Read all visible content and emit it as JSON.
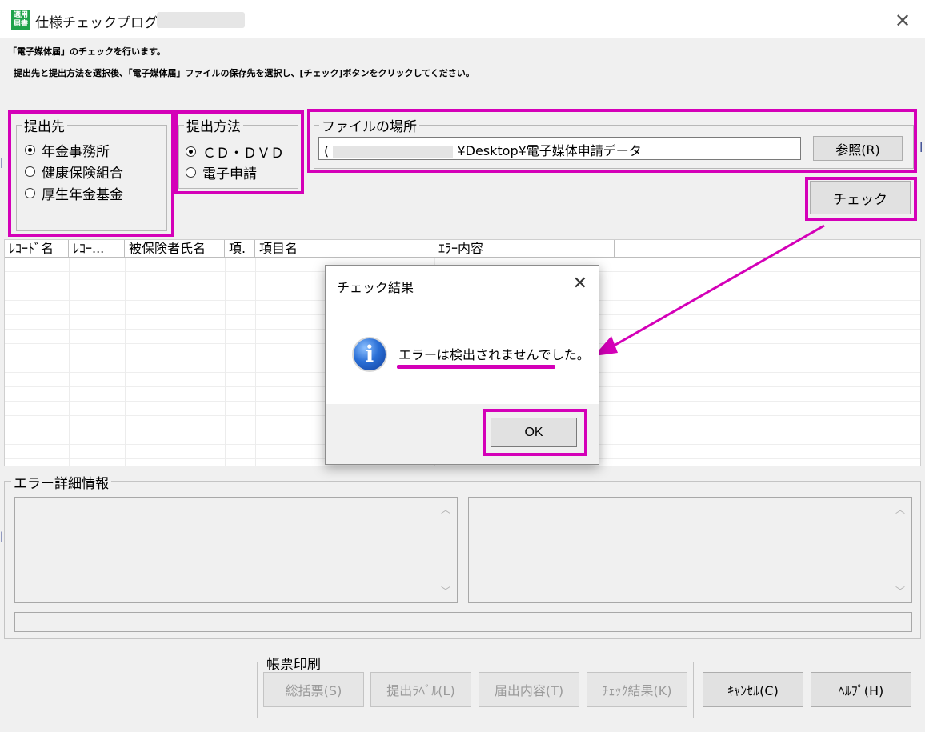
{
  "window": {
    "title": "仕様チェックプログラム",
    "app_icon_text": "適用届書",
    "close_glyph": "✕"
  },
  "instructions": {
    "line1": "「電子媒体届」のチェックを行います。",
    "line2": "提出先と提出方法を選択後、「電子媒体届」ファイルの保存先を選択し、[チェック]ボタンをクリックしてください。"
  },
  "destination": {
    "legend": "提出先",
    "options": [
      {
        "label": "年金事務所",
        "checked": true
      },
      {
        "label": "健康保険組合",
        "checked": false
      },
      {
        "label": "厚生年金基金",
        "checked": false
      }
    ]
  },
  "method": {
    "legend": "提出方法",
    "options": [
      {
        "label": "ＣＤ・ＤＶＤ",
        "checked": true
      },
      {
        "label": "電子申請",
        "checked": false
      }
    ]
  },
  "file": {
    "legend": "ファイルの場所",
    "path_prefix": "(",
    "path_value": "¥Desktop¥電子媒体申請データ",
    "browse_label": "参照(R)"
  },
  "check_button": "チェック",
  "grid": {
    "columns": [
      "ﾚｺｰﾄﾞ名",
      "ﾚｺｰ...",
      "被保険者氏名",
      "項.",
      "項目名",
      "ｴﾗｰ内容"
    ]
  },
  "error_detail": {
    "legend": "エラー詳細情報"
  },
  "print": {
    "legend": "帳票印刷",
    "buttons": [
      "総括票(S)",
      "提出ﾗﾍﾞﾙ(L)",
      "届出内容(T)",
      "ﾁｪｯｸ結果(K)"
    ]
  },
  "cancel_button": "ｷｬﾝｾﾙ(C)",
  "help_button": "ﾍﾙﾌﾟ(H)",
  "dialog": {
    "title": "チェック結果",
    "message": "エラーは検出されませんでした。",
    "ok_label": "OK",
    "close_glyph": "✕"
  },
  "colors": {
    "highlight": "#d400b8",
    "accent_green": "#1fa34a"
  }
}
